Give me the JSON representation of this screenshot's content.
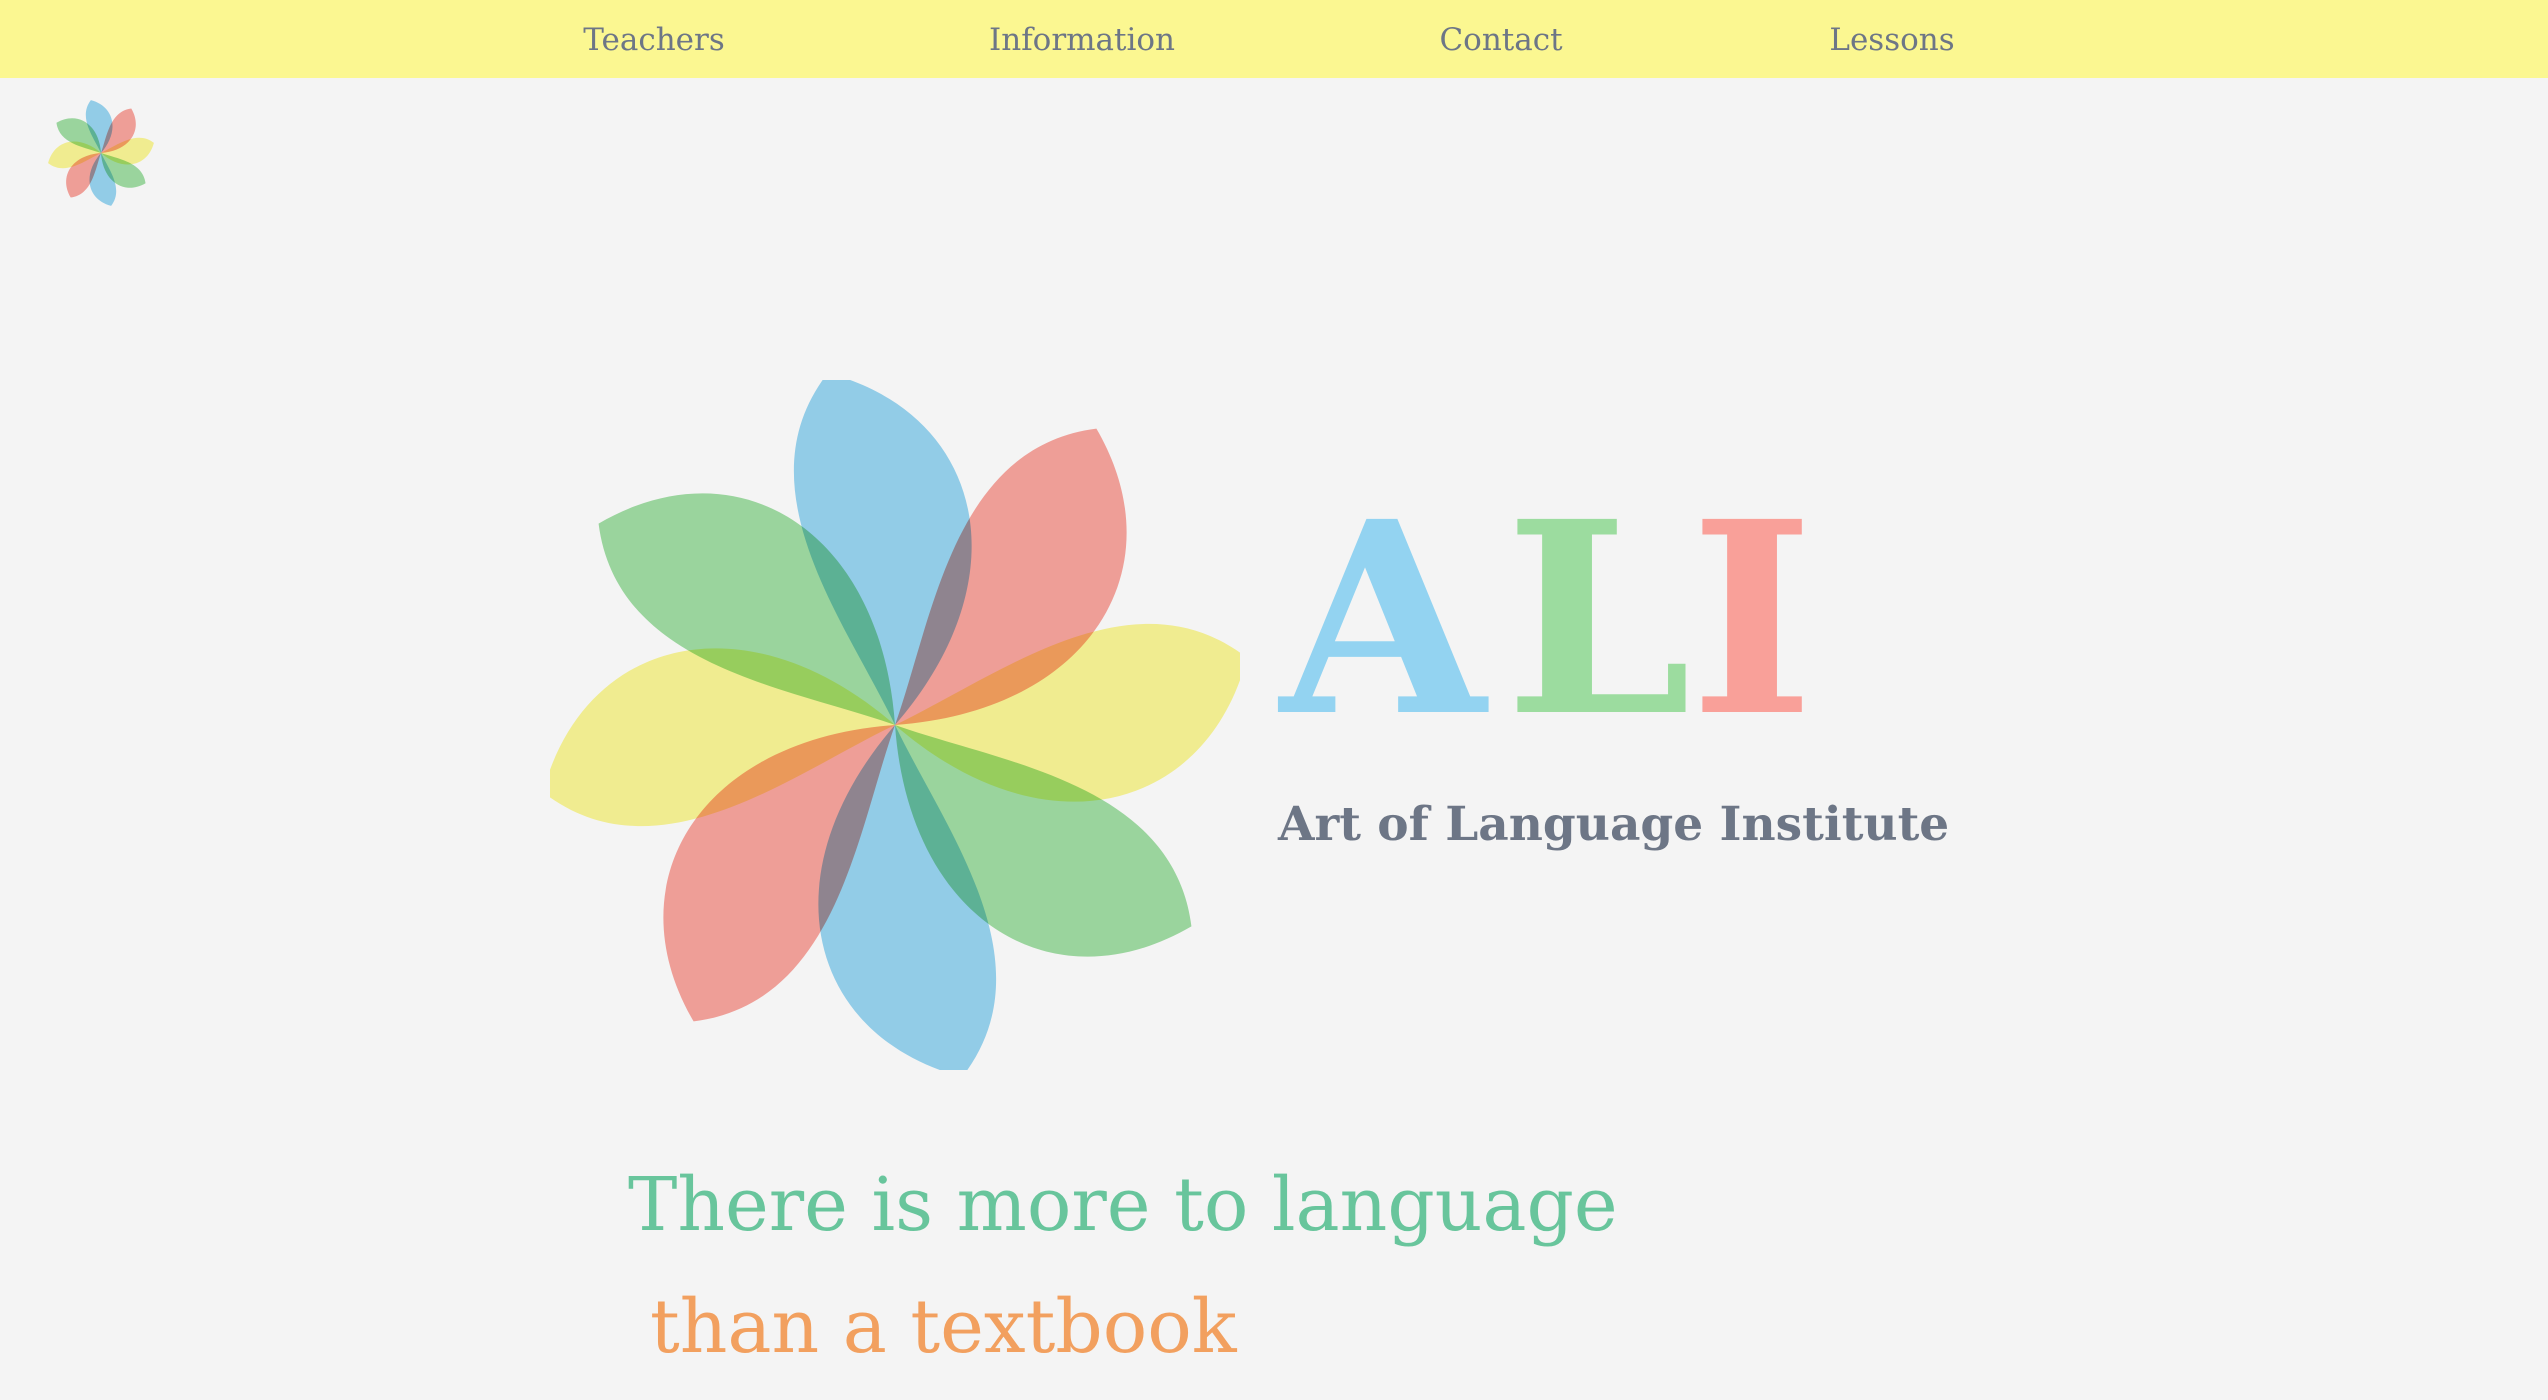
{
  "nav": {
    "links": [
      {
        "label": "Teachers"
      },
      {
        "label": "Information"
      },
      {
        "label": "Contact"
      },
      {
        "label": "Lessons"
      }
    ]
  },
  "logo": {
    "letters": [
      {
        "char": "A",
        "color": "#93d3f1"
      },
      {
        "char": "L",
        "color": "#9cdc9f"
      },
      {
        "char": "I",
        "color": "#f9a099"
      }
    ],
    "subtitle": "Art of Language Institute",
    "petal_colors": [
      "#93d3f1",
      "#f9a099",
      "#fbf791",
      "#9cdc9f",
      "#93d3f1",
      "#f9a099",
      "#fbf791",
      "#9cdc9f"
    ]
  },
  "tagline": {
    "line1": "There is more to language",
    "line2": "than a textbook"
  },
  "colors": {
    "nav_background": "#fbf791",
    "page_background": "#f4f4f4",
    "text_gray": "#6d7686",
    "green": "#68c59c",
    "orange": "#f2a05f"
  }
}
